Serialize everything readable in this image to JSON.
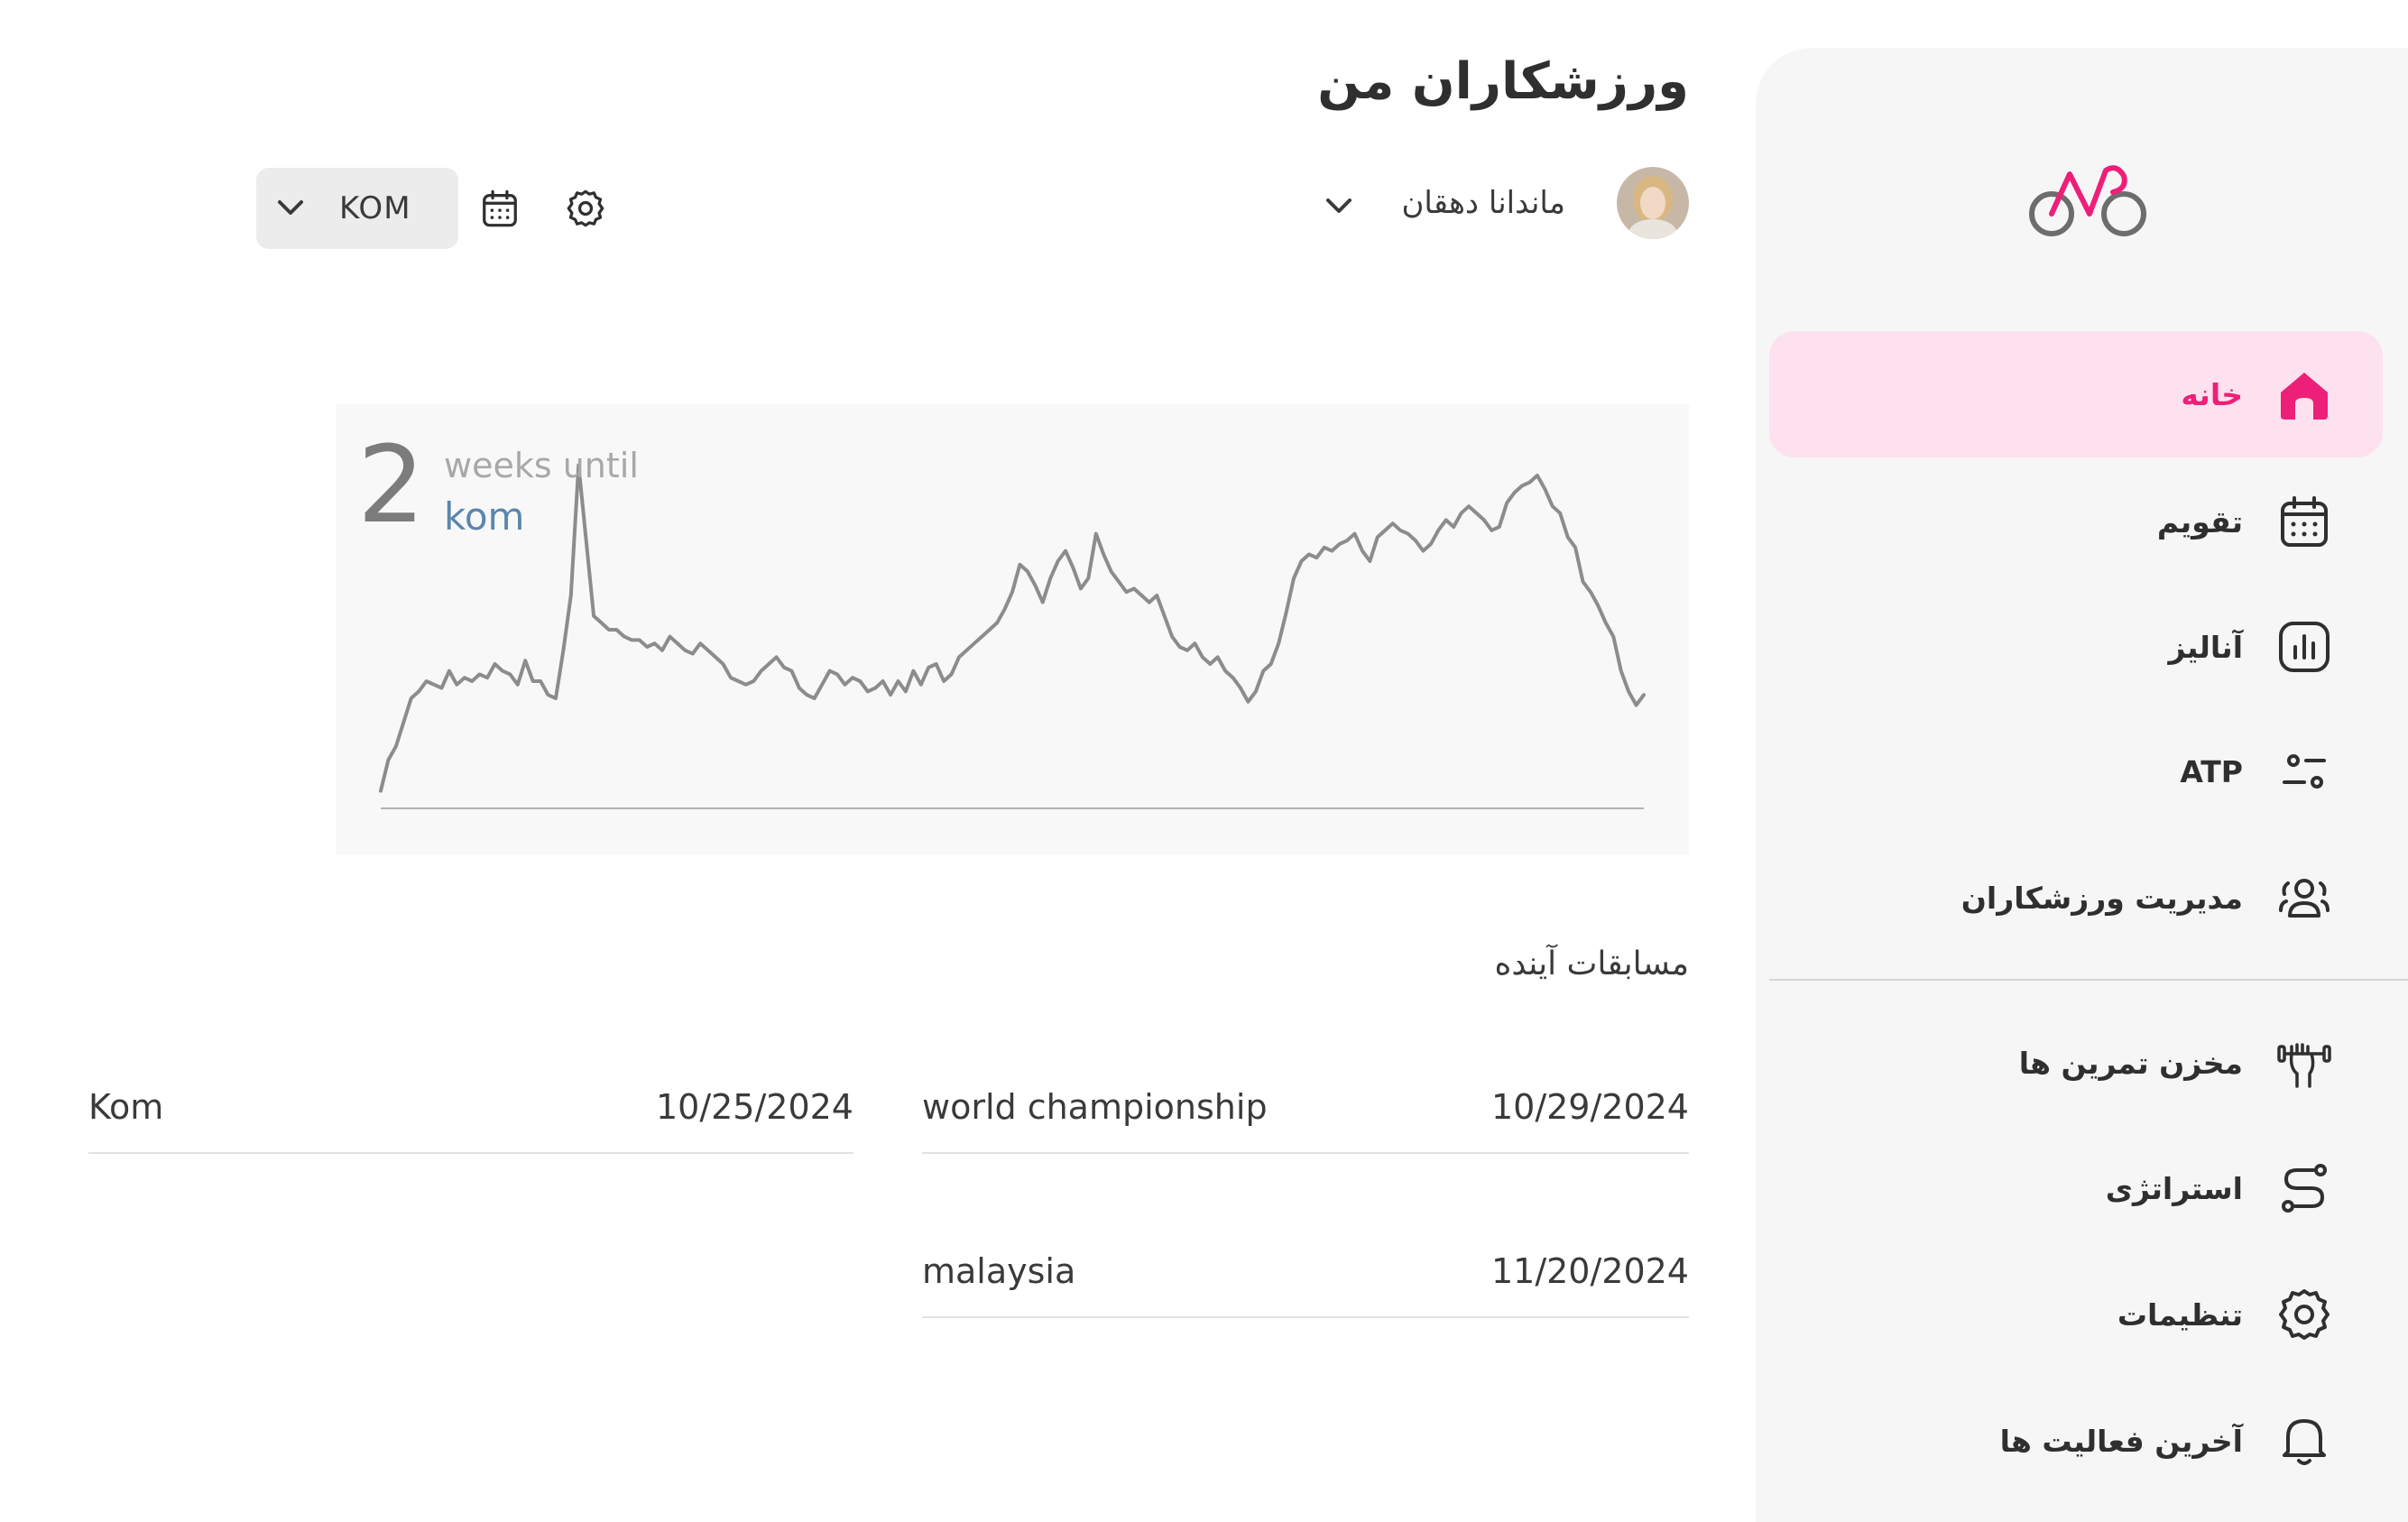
{
  "header": {
    "title": "ورزشکاران من",
    "athlete_name": "ماندانا دهقان",
    "race_select_value": "KOM"
  },
  "sidebar": {
    "items": [
      {
        "label": "خانه",
        "icon": "home-icon",
        "active": true
      },
      {
        "label": "تقویم",
        "icon": "calendar-icon"
      },
      {
        "label": "آنالیز",
        "icon": "chart-icon"
      },
      {
        "label": "ATP",
        "icon": "sliders-icon"
      },
      {
        "label": "مدیریت ورزشکاران",
        "icon": "users-icon"
      },
      {
        "label": "مخزن تمرین ها",
        "icon": "workout-library-icon"
      },
      {
        "label": "استراتژی",
        "icon": "route-icon"
      },
      {
        "label": "تنظیمات",
        "icon": "gear-icon"
      },
      {
        "label": "آخرین فعالیت ها",
        "icon": "bell-icon"
      }
    ]
  },
  "colors": {
    "accent": "#ee1f79",
    "active_bg": "#fde1ee",
    "chart_line": "#8c8c8c",
    "goal_text": "#5b86ad"
  },
  "countdown": {
    "number": "2",
    "unit_text": "weeks until",
    "goal": "kom"
  },
  "chart_data": {
    "type": "line",
    "title": "",
    "xlabel": "",
    "ylabel": "",
    "grid": false,
    "ylim": [
      0,
      100
    ],
    "series": [
      {
        "values": [
          3,
          12,
          16,
          23,
          30,
          32,
          35,
          34,
          33,
          38,
          34,
          36,
          35,
          37,
          36,
          40,
          38,
          37,
          34,
          41,
          35,
          35,
          31,
          30,
          44,
          60,
          98,
          76,
          54,
          52,
          50,
          50,
          48,
          47,
          47,
          45,
          46,
          44,
          48,
          46,
          44,
          43,
          46,
          44,
          42,
          40,
          36,
          35,
          34,
          35,
          38,
          40,
          42,
          39,
          38,
          33,
          31,
          30,
          34,
          38,
          37,
          34,
          36,
          35,
          32,
          33,
          35,
          31,
          35,
          32,
          38,
          34,
          39,
          40,
          35,
          37,
          42,
          44,
          46,
          48,
          50,
          52,
          56,
          61,
          69,
          67,
          63,
          58,
          65,
          70,
          73,
          68,
          62,
          65,
          78,
          72,
          67,
          64,
          61,
          62,
          60,
          58,
          60,
          54,
          48,
          45,
          44,
          46,
          42,
          40,
          42,
          38,
          36,
          33,
          29,
          32,
          38,
          40,
          46,
          55,
          65,
          70,
          72,
          71,
          74,
          73,
          75,
          76,
          78,
          73,
          70,
          77,
          79,
          81,
          79,
          78,
          76,
          73,
          75,
          79,
          82,
          80,
          84,
          86,
          84,
          82,
          79,
          80,
          87,
          90,
          92,
          93,
          95,
          91,
          86,
          84,
          77,
          74,
          64,
          61,
          57,
          52,
          48,
          38,
          32,
          28,
          31
        ]
      }
    ]
  },
  "races": {
    "heading": "مسابقات آینده",
    "list": [
      {
        "name": "Kom",
        "date": "10/25/2024"
      },
      {
        "name": "world championship",
        "date": "10/29/2024"
      },
      {
        "name": "malaysia",
        "date": "11/20/2024"
      }
    ]
  }
}
